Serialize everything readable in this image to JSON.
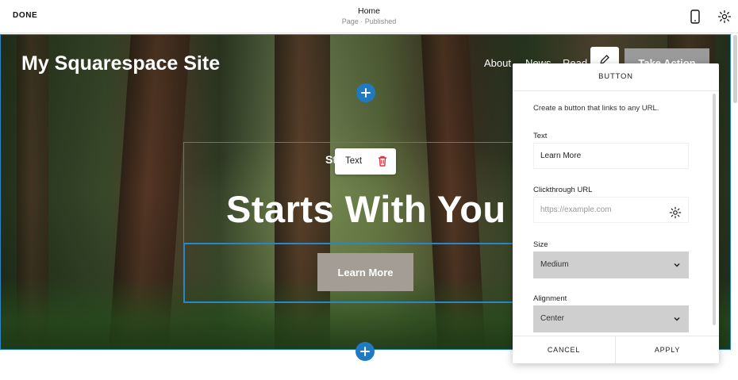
{
  "topbar": {
    "done_label": "DONE",
    "page_title": "Home",
    "page_status": "Page · Published",
    "mobile_icon": "mobile-preview-icon",
    "settings_icon": "gear-icon"
  },
  "site": {
    "title": "My Squarespace Site",
    "nav": [
      "About",
      "News",
      "Read"
    ],
    "cta": "Take Action"
  },
  "hero": {
    "eyebrow": "Story",
    "headline": "Starts With You",
    "button": "Learn More"
  },
  "text_popover": {
    "label": "Text",
    "delete_icon": "trash-icon"
  },
  "panel": {
    "title": "BUTTON",
    "description": "Create a button that links to any URL.",
    "text_label": "Text",
    "text_value": "Learn More",
    "url_label": "Clickthrough URL",
    "url_placeholder": "https://example.com",
    "size_label": "Size",
    "size_value": "Medium",
    "alignment_label": "Alignment",
    "alignment_value": "Center",
    "cancel_label": "CANCEL",
    "apply_label": "APPLY"
  },
  "colors": {
    "accent": "#2b86c7",
    "plus_button": "#1f7ac1",
    "delete": "#e0323a",
    "hero_button": "#a39d95"
  }
}
